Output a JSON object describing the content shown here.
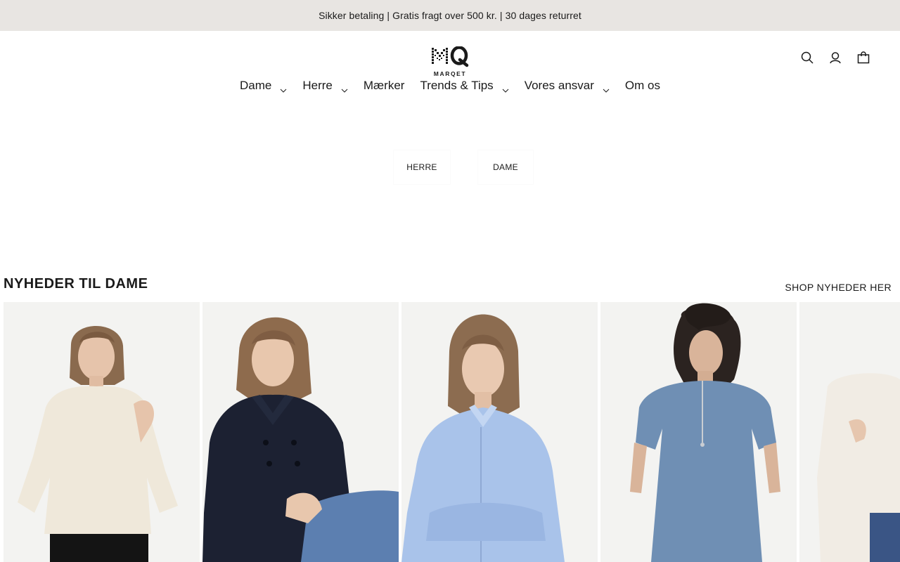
{
  "announcement": "Sikker betaling | Gratis fragt over 500 kr. | 30 dages returret",
  "brand": {
    "logo_text": "MARQET"
  },
  "header_icons": [
    "search-icon",
    "account-icon",
    "bag-icon"
  ],
  "nav": {
    "items": [
      {
        "label": "Dame",
        "dropdown": true
      },
      {
        "label": "Herre",
        "dropdown": true
      },
      {
        "label": "Mærker",
        "dropdown": false
      },
      {
        "label": "Trends & Tips",
        "dropdown": true
      },
      {
        "label": "Vores ansvar",
        "dropdown": true
      },
      {
        "label": "Om os",
        "dropdown": false
      }
    ]
  },
  "gender_buttons": {
    "herre": "HERRE",
    "dame": "DAME"
  },
  "new_arrivals": {
    "title": "NYHEDER TIL DAME",
    "shop_link": "SHOP NYHEDER HER",
    "products": [
      {
        "garment": "cream knit sweater",
        "color": "#efe8da"
      },
      {
        "garment": "navy double-breasted cardigan",
        "color": "#1c2132"
      },
      {
        "garment": "light blue ruffle shirt",
        "color": "#a9c3ea"
      },
      {
        "garment": "denim zip dress",
        "color": "#6f8fb4"
      },
      {
        "garment": "off-white knit cardigan",
        "color": "#f1ece4"
      }
    ]
  },
  "colors": {
    "announcement_bg": "#e8e5e2",
    "text": "#1a1a1a"
  }
}
